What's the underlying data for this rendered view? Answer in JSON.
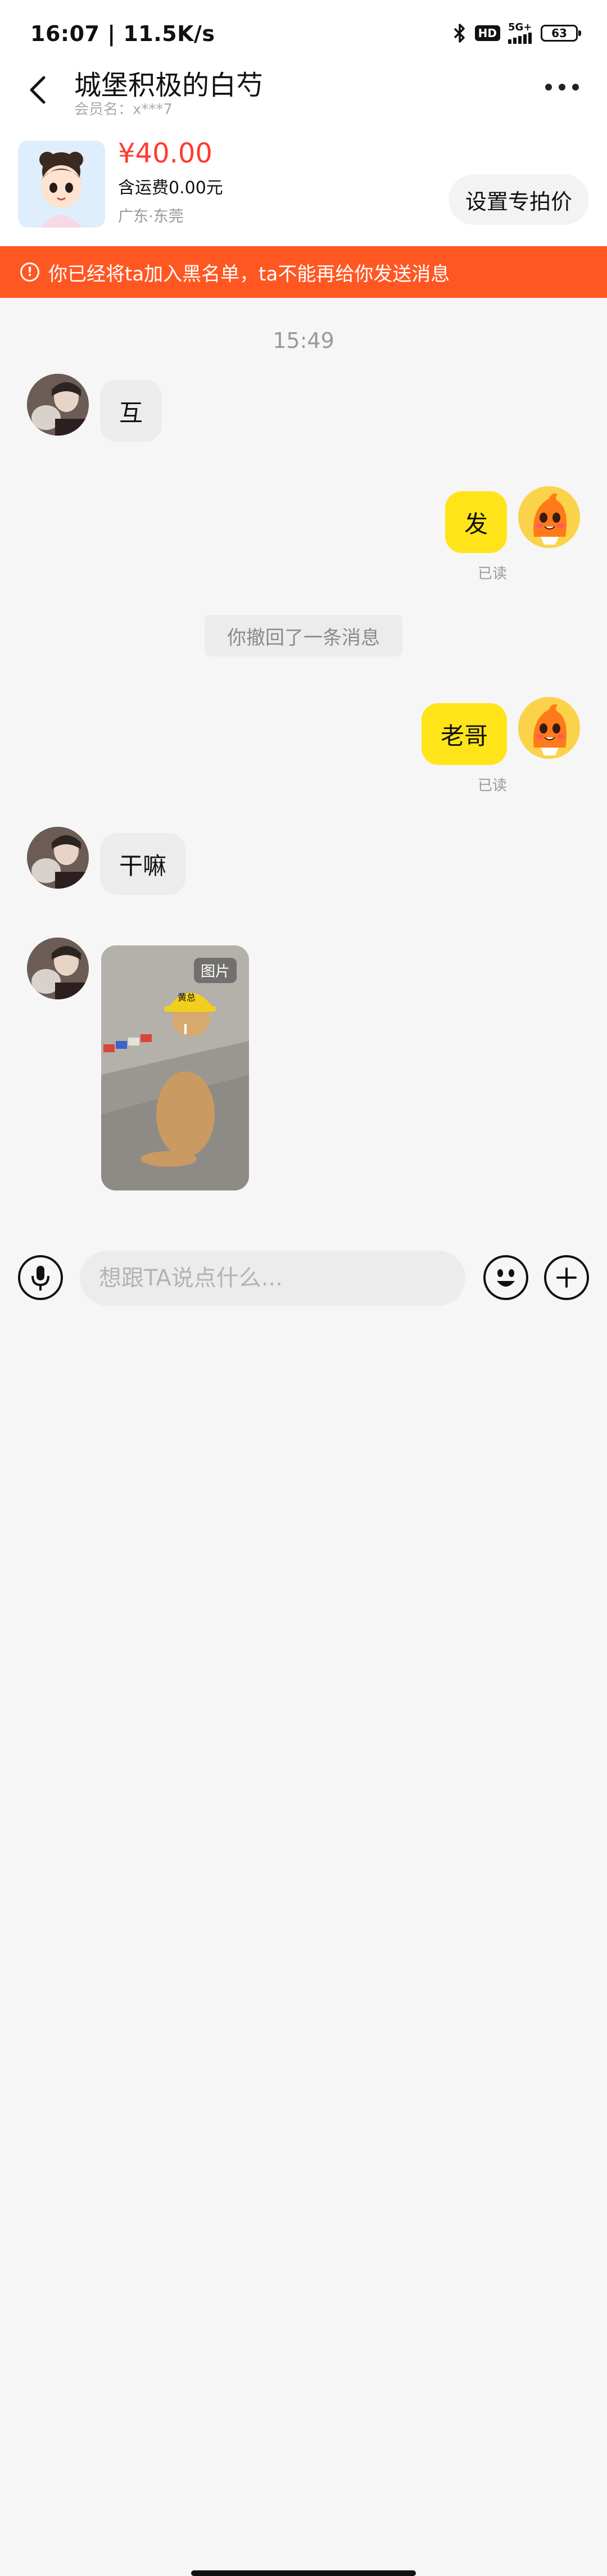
{
  "status_bar": {
    "time": "16:07",
    "net_speed": "11.5K/s",
    "hd_label": "HD",
    "network_label": "5G+",
    "battery": "63"
  },
  "header": {
    "shop_name": "城堡积极的白芍",
    "member_name": "会员名：x***7"
  },
  "product": {
    "price": "¥40.00",
    "shipping": "含运费0.00元",
    "location": "广东·东莞",
    "set_price_label": "设置专拍价"
  },
  "banner": {
    "icon_text": "!",
    "text": "你已经将ta加入黑名单，ta不能再给你发送消息"
  },
  "chat": {
    "time_label": "15:49",
    "messages": [
      {
        "side": "left",
        "text": "互"
      },
      {
        "side": "right",
        "text": "发",
        "status": "已读"
      },
      {
        "side": "system",
        "text": "你撤回了一条消息"
      },
      {
        "side": "right",
        "text": "老哥",
        "status": "已读"
      },
      {
        "side": "left",
        "text": "干嘛"
      },
      {
        "side": "left",
        "type": "image",
        "badge": "图片",
        "helmet_text": "黄总"
      }
    ]
  },
  "input": {
    "placeholder": "想跟TA说点什么..."
  },
  "colors": {
    "accent_red": "#ff3b30",
    "banner_orange": "#ff5722",
    "my_bubble": "#ffe41a",
    "their_bubble": "#ececec"
  },
  "icons": [
    "back-icon",
    "more-icon",
    "bluetooth-icon",
    "signal-icon",
    "battery-icon",
    "alert-icon",
    "microphone-icon",
    "emoji-icon",
    "plus-icon"
  ]
}
